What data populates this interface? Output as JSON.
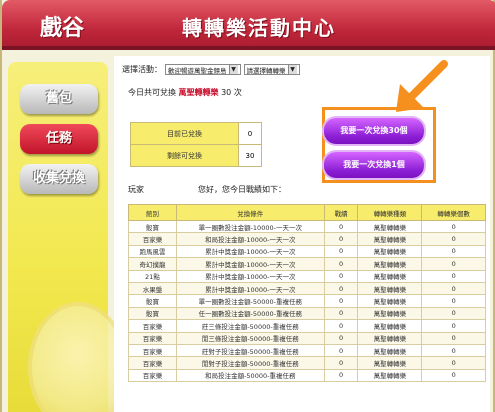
{
  "header": {
    "logo": "戲谷",
    "title": "轉轉樂活動中心"
  },
  "sidebar": {
    "items": [
      {
        "label": "舊包",
        "active": false
      },
      {
        "label": "任務",
        "active": true
      },
      {
        "label": "收集兌換",
        "active": false
      }
    ]
  },
  "filters": {
    "label": "選擇活動：",
    "activity": "歡迎暢遊萬聖金鏢島",
    "type": "請選擇轉轉樂"
  },
  "exchange": {
    "prefix": "今日共可兌換",
    "item": "萬聖轉轉樂",
    "count": "30 次"
  },
  "stats": [
    {
      "label": "目前已兌換",
      "value": "0"
    },
    {
      "label": "剩餘可兌換",
      "value": "30"
    }
  ],
  "buttons": {
    "exchange_30": "我要一次兌換30個",
    "exchange_1": "我要一次兌換1個"
  },
  "player": {
    "label": "玩家",
    "greeting": "您好，您今日戰績如下："
  },
  "table": {
    "headers": [
      "館別",
      "兌換條件",
      "戰績",
      "轉轉樂種類",
      "轉轉樂個數"
    ],
    "rows": [
      [
        "骰寶",
        "單一圈數投注金額-10000-一天一次",
        "0",
        "萬聖轉轉樂",
        "0"
      ],
      [
        "百家樂",
        "和局投注金額-10000-一天一次",
        "0",
        "萬聖轉轉樂",
        "0"
      ],
      [
        "跑馬風雲",
        "累計中獎金額-10000-一天一次",
        "0",
        "萬聖轉轉樂",
        "0"
      ],
      [
        "奇幻撲龍",
        "累計中獎金額-10000-一天一次",
        "0",
        "萬聖轉轉樂",
        "0"
      ],
      [
        "21點",
        "累計中獎金額-10000-一天一次",
        "0",
        "萬聖轉轉樂",
        "0"
      ],
      [
        "水果盤",
        "累計中獎金額-10000-一天一次",
        "0",
        "萬聖轉轉樂",
        "0"
      ],
      [
        "骰寶",
        "單一圈數投注金額-50000-重複任務",
        "0",
        "萬聖轉轉樂",
        "0"
      ],
      [
        "骰寶",
        "任一圈數投注金額-50000-重複任務",
        "0",
        "萬聖轉轉樂",
        "0"
      ],
      [
        "百家樂",
        "莊三條投注金額-50000-重複任務",
        "0",
        "萬聖轉轉樂",
        "0"
      ],
      [
        "百家樂",
        "閒三條投注金額-50000-重複任務",
        "0",
        "萬聖轉轉樂",
        "0"
      ],
      [
        "百家樂",
        "莊對子投注金額-50000-重複任務",
        "0",
        "萬聖轉轉樂",
        "0"
      ],
      [
        "百家樂",
        "閒對子投注金額-50000-重複任務",
        "0",
        "萬聖轉轉樂",
        "0"
      ],
      [
        "百家樂",
        "和局投注金額-50000-重複任務",
        "0",
        "萬聖轉轉樂",
        "0"
      ]
    ]
  }
}
